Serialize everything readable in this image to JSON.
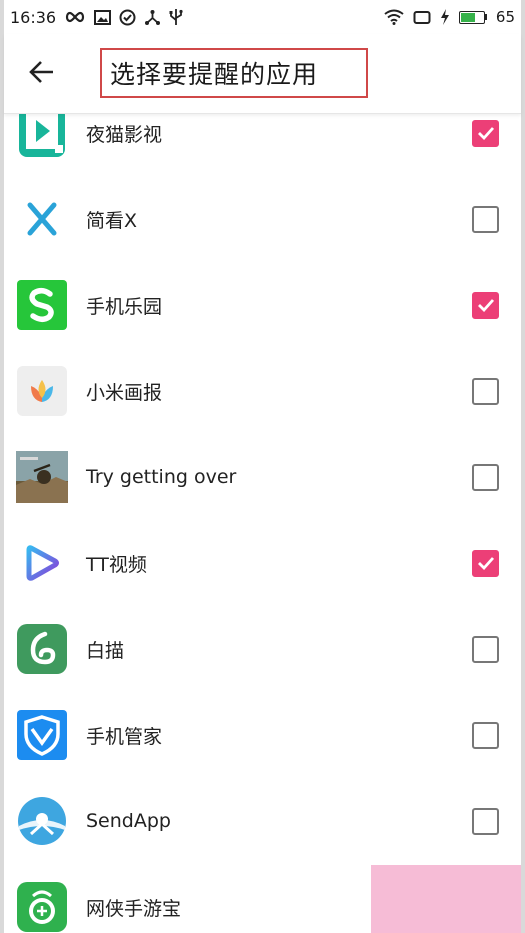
{
  "status_bar": {
    "time": "16:36",
    "battery_level": "65",
    "battery_fraction": 0.65,
    "battery_color": "#36b24a",
    "icons_left": [
      "infinity-icon",
      "gallery-icon",
      "check-circle-icon",
      "share-icon",
      "usb-icon"
    ],
    "icons_right": [
      "wifi-icon",
      "rotate-icon",
      "charging-icon",
      "battery-icon"
    ]
  },
  "app_bar": {
    "back_icon": "arrow-left-icon",
    "title": "选择要提醒的应用"
  },
  "colors": {
    "checkbox_checked": "#ec3f77",
    "title_highlight_border": "#d04848",
    "corner_block": "#f6bcd6"
  },
  "apps": [
    {
      "name": "夜猫影视",
      "icon": "play-tile-icon",
      "checked": true
    },
    {
      "name": "简看X",
      "icon": "x-letter-icon",
      "checked": false
    },
    {
      "name": "手机乐园",
      "icon": "s-letter-icon",
      "checked": true
    },
    {
      "name": "小米画报",
      "icon": "tulip-icon",
      "checked": false
    },
    {
      "name": "Try getting over",
      "icon": "game-thumbnail-icon",
      "checked": false
    },
    {
      "name": "TT视频",
      "icon": "play-triangle-icon",
      "checked": true
    },
    {
      "name": "白描",
      "icon": "swirl-icon",
      "checked": false
    },
    {
      "name": "手机管家",
      "icon": "shield-icon",
      "checked": false
    },
    {
      "name": "SendApp",
      "icon": "sendapp-globe-icon",
      "checked": false
    },
    {
      "name": "网侠手游宝",
      "icon": "game-bag-icon",
      "checked": false
    }
  ]
}
